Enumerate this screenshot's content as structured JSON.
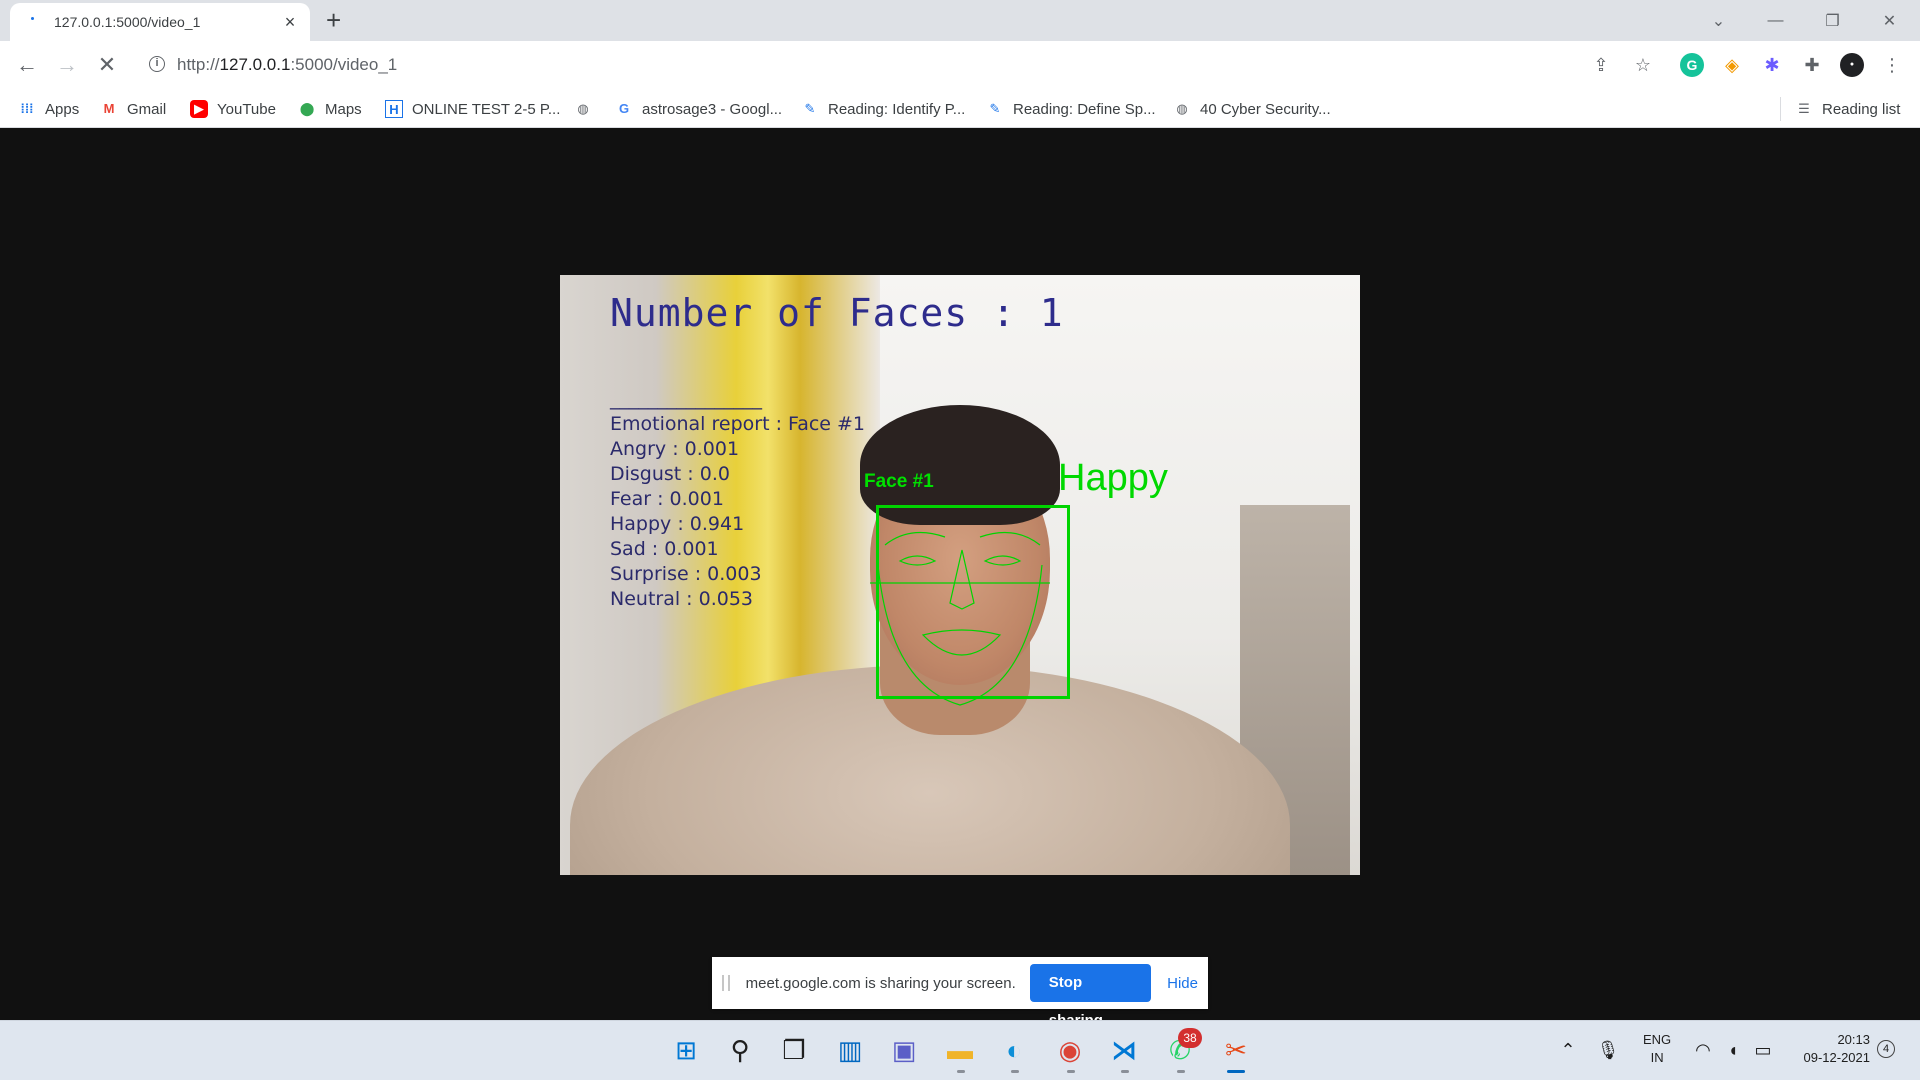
{
  "tab": {
    "title": "127.0.0.1:5000/video_1",
    "close": "×",
    "new_tab": "+"
  },
  "window_controls": {
    "dropdown": "⌄",
    "minimize": "—",
    "restore": "❐",
    "close": "✕"
  },
  "address_bar": {
    "url_scheme": "http://",
    "url_host": "127.0.0.1",
    "url_rest": ":5000/video_1"
  },
  "bookmarks": [
    {
      "label": "Apps",
      "icon": "apps-grid-icon"
    },
    {
      "label": "Gmail",
      "icon": "gmail-icon"
    },
    {
      "label": "YouTube",
      "icon": "youtube-icon"
    },
    {
      "label": "Maps",
      "icon": "maps-pin-icon"
    },
    {
      "label": "ONLINE TEST 2-5 P...",
      "icon": "h-logo-icon"
    },
    {
      "label": "",
      "icon": "globe-icon"
    },
    {
      "label": "astrosage3 - Googl...",
      "icon": "google-icon"
    },
    {
      "label": "Reading: Identify P...",
      "icon": "reading-icon"
    },
    {
      "label": "Reading: Define Sp...",
      "icon": "reading-icon"
    },
    {
      "label": "40 Cyber Security...",
      "icon": "globe-icon"
    }
  ],
  "reading_list": "Reading list",
  "video": {
    "faces_title": "Number of Faces : 1",
    "separator": "________________",
    "report_header": "Emotional report : Face #1",
    "emotions": [
      {
        "text": "Angry : 0.001"
      },
      {
        "text": "Disgust : 0.0"
      },
      {
        "text": "Fear : 0.001"
      },
      {
        "text": "Happy : 0.941"
      },
      {
        "text": "Sad : 0.001"
      },
      {
        "text": "Surprise : 0.003"
      },
      {
        "text": "Neutral : 0.053"
      }
    ],
    "face_label": "Face #1",
    "emotion_label": "Happy"
  },
  "share_banner": {
    "message": "meet.google.com is sharing your screen.",
    "stop_label": "Stop sharing",
    "hide_label": "Hide"
  },
  "taskbar": {
    "whatsapp_badge": "38",
    "lang_line1": "ENG",
    "lang_line2": "IN",
    "time": "20:13",
    "date": "09-12-2021",
    "notifications": "4"
  },
  "colors": {
    "accent": "#1a73e8",
    "detection_green": "#00d800",
    "overlay_text": "#2e2c8c",
    "page_bg": "#111111"
  }
}
